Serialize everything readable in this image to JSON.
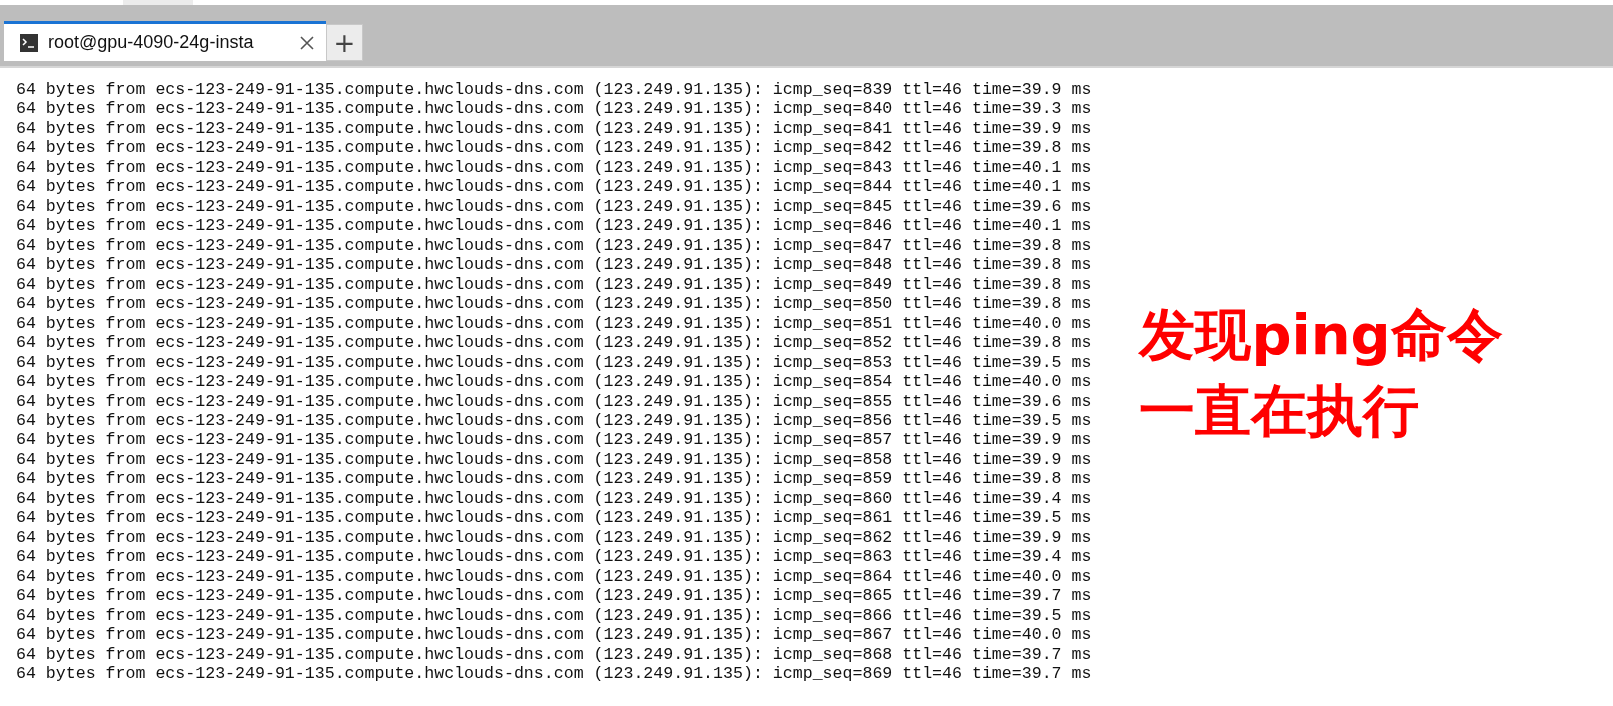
{
  "tabs": [
    {
      "label": "root@gpu-4090-24g-insta",
      "selected": true
    }
  ],
  "new_tab": "+",
  "terminal_lines": [
    "64 bytes from ecs-123-249-91-135.compute.hwclouds-dns.com (123.249.91.135): icmp_seq=839 ttl=46 time=39.9 ms",
    "64 bytes from ecs-123-249-91-135.compute.hwclouds-dns.com (123.249.91.135): icmp_seq=840 ttl=46 time=39.3 ms",
    "64 bytes from ecs-123-249-91-135.compute.hwclouds-dns.com (123.249.91.135): icmp_seq=841 ttl=46 time=39.9 ms",
    "64 bytes from ecs-123-249-91-135.compute.hwclouds-dns.com (123.249.91.135): icmp_seq=842 ttl=46 time=39.8 ms",
    "64 bytes from ecs-123-249-91-135.compute.hwclouds-dns.com (123.249.91.135): icmp_seq=843 ttl=46 time=40.1 ms",
    "64 bytes from ecs-123-249-91-135.compute.hwclouds-dns.com (123.249.91.135): icmp_seq=844 ttl=46 time=40.1 ms",
    "64 bytes from ecs-123-249-91-135.compute.hwclouds-dns.com (123.249.91.135): icmp_seq=845 ttl=46 time=39.6 ms",
    "64 bytes from ecs-123-249-91-135.compute.hwclouds-dns.com (123.249.91.135): icmp_seq=846 ttl=46 time=40.1 ms",
    "64 bytes from ecs-123-249-91-135.compute.hwclouds-dns.com (123.249.91.135): icmp_seq=847 ttl=46 time=39.8 ms",
    "64 bytes from ecs-123-249-91-135.compute.hwclouds-dns.com (123.249.91.135): icmp_seq=848 ttl=46 time=39.8 ms",
    "64 bytes from ecs-123-249-91-135.compute.hwclouds-dns.com (123.249.91.135): icmp_seq=849 ttl=46 time=39.8 ms",
    "64 bytes from ecs-123-249-91-135.compute.hwclouds-dns.com (123.249.91.135): icmp_seq=850 ttl=46 time=39.8 ms",
    "64 bytes from ecs-123-249-91-135.compute.hwclouds-dns.com (123.249.91.135): icmp_seq=851 ttl=46 time=40.0 ms",
    "64 bytes from ecs-123-249-91-135.compute.hwclouds-dns.com (123.249.91.135): icmp_seq=852 ttl=46 time=39.8 ms",
    "64 bytes from ecs-123-249-91-135.compute.hwclouds-dns.com (123.249.91.135): icmp_seq=853 ttl=46 time=39.5 ms",
    "64 bytes from ecs-123-249-91-135.compute.hwclouds-dns.com (123.249.91.135): icmp_seq=854 ttl=46 time=40.0 ms",
    "64 bytes from ecs-123-249-91-135.compute.hwclouds-dns.com (123.249.91.135): icmp_seq=855 ttl=46 time=39.6 ms",
    "64 bytes from ecs-123-249-91-135.compute.hwclouds-dns.com (123.249.91.135): icmp_seq=856 ttl=46 time=39.5 ms",
    "64 bytes from ecs-123-249-91-135.compute.hwclouds-dns.com (123.249.91.135): icmp_seq=857 ttl=46 time=39.9 ms",
    "64 bytes from ecs-123-249-91-135.compute.hwclouds-dns.com (123.249.91.135): icmp_seq=858 ttl=46 time=39.9 ms",
    "64 bytes from ecs-123-249-91-135.compute.hwclouds-dns.com (123.249.91.135): icmp_seq=859 ttl=46 time=39.8 ms",
    "64 bytes from ecs-123-249-91-135.compute.hwclouds-dns.com (123.249.91.135): icmp_seq=860 ttl=46 time=39.4 ms",
    "64 bytes from ecs-123-249-91-135.compute.hwclouds-dns.com (123.249.91.135): icmp_seq=861 ttl=46 time=39.5 ms",
    "64 bytes from ecs-123-249-91-135.compute.hwclouds-dns.com (123.249.91.135): icmp_seq=862 ttl=46 time=39.9 ms",
    "64 bytes from ecs-123-249-91-135.compute.hwclouds-dns.com (123.249.91.135): icmp_seq=863 ttl=46 time=39.4 ms",
    "64 bytes from ecs-123-249-91-135.compute.hwclouds-dns.com (123.249.91.135): icmp_seq=864 ttl=46 time=40.0 ms",
    "64 bytes from ecs-123-249-91-135.compute.hwclouds-dns.com (123.249.91.135): icmp_seq=865 ttl=46 time=39.7 ms",
    "64 bytes from ecs-123-249-91-135.compute.hwclouds-dns.com (123.249.91.135): icmp_seq=866 ttl=46 time=39.5 ms",
    "64 bytes from ecs-123-249-91-135.compute.hwclouds-dns.com (123.249.91.135): icmp_seq=867 ttl=46 time=40.0 ms",
    "64 bytes from ecs-123-249-91-135.compute.hwclouds-dns.com (123.249.91.135): icmp_seq=868 ttl=46 time=39.7 ms",
    "64 bytes from ecs-123-249-91-135.compute.hwclouds-dns.com (123.249.91.135): icmp_seq=869 ttl=46 time=39.7 ms"
  ],
  "annotation": [
    "发现ping命令",
    "一直在执行"
  ]
}
